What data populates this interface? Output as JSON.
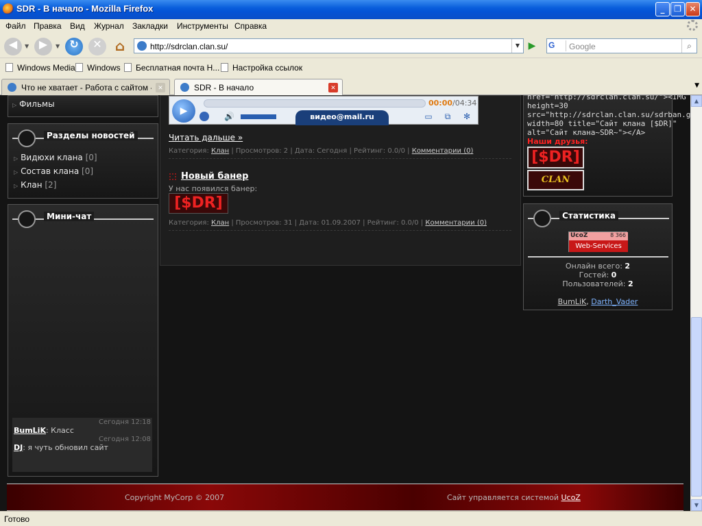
{
  "window": {
    "title": "SDR - В начало - Mozilla Firefox",
    "min": "_",
    "max": "❐",
    "close": "✕"
  },
  "menu": [
    "Файл",
    "Правка",
    "Вид",
    "Журнал",
    "Закладки",
    "Инструменты",
    "Справка"
  ],
  "nav": {
    "url": "http://sdrclan.clan.su/",
    "search_placeholder": "Google",
    "search_engine": "G"
  },
  "bookmarks": [
    "Windows Media",
    "Windows",
    "Бесплатная почта Н...",
    "Настройка ссылок"
  ],
  "tabs": [
    {
      "label": "Что не хватает - Работа с сайтом - ..."
    },
    {
      "label": "SDR - В начало"
    }
  ],
  "status": "Готово",
  "sidebar_left": {
    "films": "Фильмы",
    "news_sections_title": "Разделы новостей",
    "categories": [
      {
        "label": "Видюхи клана",
        "count": "[0]"
      },
      {
        "label": "Состав клана",
        "count": "[0]"
      },
      {
        "label": "Клан",
        "count": "[2]"
      }
    ],
    "minichat_title": "Мини-чат",
    "chat": [
      {
        "time": "Сегодня 12:18",
        "user": "BumLiK",
        "text": ": Класс"
      },
      {
        "time": "Сегодня 12:08",
        "user": "DJ",
        "text": ": я чуть обновил сайт"
      }
    ]
  },
  "player": {
    "time_current": "00:00",
    "time_total": "/04:34",
    "logo": "видео@mail.ru"
  },
  "main": {
    "read_more": "Читать дальше »",
    "post1_meta": {
      "category_label": "Категория: ",
      "category": "Клан",
      "rest": " | Просмотров: 2 | Дата: Сегодня | Рейтинг: 0.0/0 | ",
      "comments": "Комментарии (0)"
    },
    "post2_title": "Новый банер",
    "post2_text": "У нас появился банер:",
    "banner_text": "[$DR]",
    "post2_meta": {
      "category_label": "Категория: ",
      "category": "Клан",
      "rest": " | Просмотров: 31 | Дата: 01.09.2007 | Рейтинг: 0.0/0 | ",
      "comments": "Комментарии (0)"
    }
  },
  "sidebar_right": {
    "code_lines": [
      "href=\"http://sdrclan.clan.su/\"><IMG",
      "height=30",
      "src=\"http://sdrclan.clan.su/sdrban.gif\"",
      "width=80 title=\"Сайт клана [$DR]\"",
      "alt=\"Сайт клана~SDR~\"></A>"
    ],
    "friends_title": "Наши друзья:",
    "friend1": "[$DR]",
    "friend2": "CLAN",
    "stats_title": "Статистика",
    "ucoz_top": "UcoZ",
    "ucoz_num": "8 366",
    "ucoz_bottom": "Web-Services",
    "online_label": "Онлайн всего: ",
    "online": "2",
    "guests_label": "Гостей: ",
    "guests": "0",
    "users_label": "Пользователей: ",
    "users": "2",
    "user1": "BumLiK",
    "user_sep": ", ",
    "user2": "Darth_Vader"
  },
  "footer": {
    "copyright": "Copyright MyCorp © 2007",
    "managed_prefix": "Сайт управляется системой ",
    "managed_link": "UcoZ"
  }
}
